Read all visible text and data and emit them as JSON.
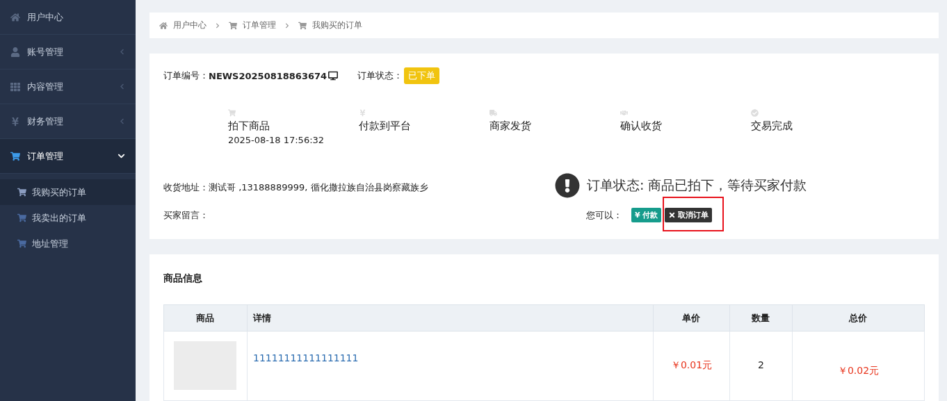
{
  "sidebar": {
    "items": [
      {
        "label": "用户中心"
      },
      {
        "label": "账号管理",
        "expanded": false
      },
      {
        "label": "内容管理",
        "expanded": false
      },
      {
        "label": "财务管理",
        "expanded": false
      },
      {
        "label": "订单管理",
        "expanded": true,
        "children": [
          {
            "label": "我购买的订单",
            "selected": true
          },
          {
            "label": "我卖出的订单",
            "selected": false
          },
          {
            "label": "地址管理",
            "selected": false
          }
        ]
      }
    ]
  },
  "breadcrumb": [
    "用户中心",
    "订单管理",
    "我购买的订单"
  ],
  "order": {
    "number_label": "订单编号：",
    "number": "NEWS20250818863674",
    "status_label": "订单状态：",
    "status": "已下单",
    "steps": [
      {
        "label": "拍下商品",
        "time": "2025-08-18 17:56:32"
      },
      {
        "label": "付款到平台"
      },
      {
        "label": "商家发货"
      },
      {
        "label": "确认收货"
      },
      {
        "label": "交易完成"
      }
    ],
    "address_label": "收货地址：",
    "address": "测试哥 ,13188889999, 循化撒拉族自治县岗察藏族乡",
    "message_label": "买家留言：",
    "notice": "订单状态: 商品已拍下，等待买家付款",
    "actions_label": "您可以：",
    "actions": [
      {
        "kind": "pay",
        "icon": "¥",
        "label": "付款",
        "highlighted": false
      },
      {
        "kind": "cancel",
        "label": "取消订单",
        "highlighted": true
      }
    ]
  },
  "products": {
    "title": "商品信息",
    "columns": [
      "商品",
      "详情",
      "单价",
      "数量",
      "总价"
    ],
    "rows": [
      {
        "detail": "11111111111111111",
        "price": "￥0.01元",
        "quantity": "2",
        "total": "￥0.02元"
      }
    ]
  }
}
